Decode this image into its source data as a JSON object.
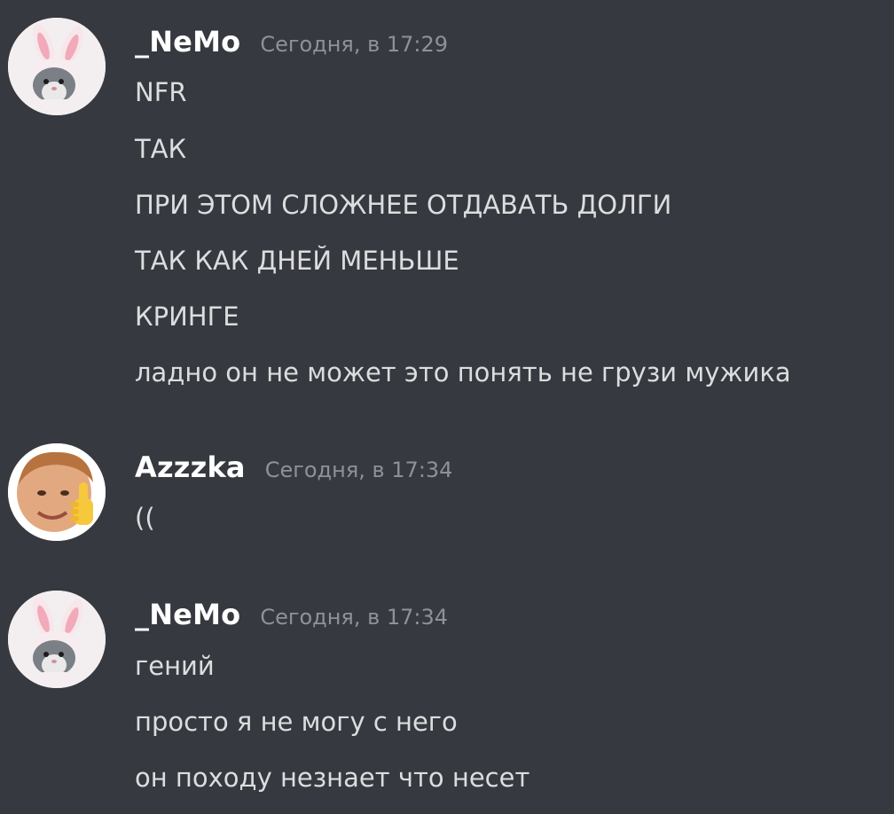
{
  "messages": [
    {
      "username": "_NeMo",
      "timestamp": "Сегодня, в 17:29",
      "avatar_icon": "bunny-ears-cat-avatar",
      "lines": [
        "NFR",
        "ТАК",
        "ПРИ ЭТОМ СЛОЖНЕЕ ОТДАВАТЬ ДОЛГИ",
        "ТАК КАК ДНЕЙ МЕНЬШЕ",
        "КРИНГЕ",
        "ладно он не может это понять не грузи мужика"
      ]
    },
    {
      "username": "Azzzka",
      "timestamp": "Сегодня, в 17:34",
      "avatar_icon": "thumbs-up-face-avatar",
      "lines": [
        "(("
      ]
    },
    {
      "username": "_NeMo",
      "timestamp": "Сегодня, в 17:34",
      "avatar_icon": "bunny-ears-cat-avatar",
      "lines": [
        "гений",
        "просто я не могу с него",
        "он походу незнает что несет"
      ]
    }
  ],
  "colors": {
    "background": "#36393f",
    "username": "#ffffff",
    "timestamp": "#8e9297",
    "message_text": "#dcddde"
  }
}
